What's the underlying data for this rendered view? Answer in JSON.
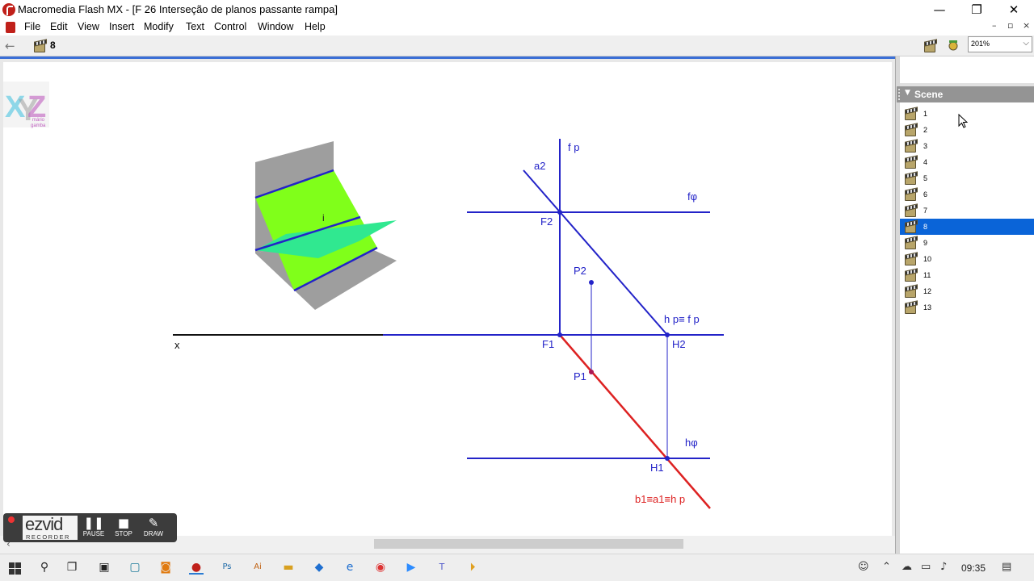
{
  "window": {
    "title": "Macromedia Flash MX - [F 26 Interseção de planos passante rampa]",
    "minimize": "—",
    "maximize": "❐",
    "close": "✕"
  },
  "menu": {
    "items": [
      "File",
      "Edit",
      "View",
      "Insert",
      "Modify",
      "Text",
      "Control",
      "Window",
      "Help"
    ],
    "doc_controls": [
      "–",
      "▫",
      "×"
    ]
  },
  "editbar": {
    "back_glyph": "←",
    "current_scene": "8",
    "zoom": "201%"
  },
  "scene_panel": {
    "title": "Scene",
    "scenes": [
      "1",
      "2",
      "3",
      "4",
      "5",
      "6",
      "7",
      "8",
      "9",
      "10",
      "11",
      "12",
      "13"
    ],
    "selected": "8"
  },
  "stage": {
    "logo_letters": [
      "X",
      "Y",
      "Z"
    ],
    "logo_caption": [
      "mário",
      "gamba"
    ],
    "labels": {
      "fp": "f p",
      "a2": "a2",
      "fphi": "fφ",
      "F2": "F2",
      "P2": "P2",
      "hpfp": "h p≡ f p",
      "x": "x",
      "F1": "F1",
      "H2": "H2",
      "P1": "P1",
      "hphi": "hφ",
      "H1": "H1",
      "b1": "b1≡a1≡h p",
      "i": "i"
    },
    "colors": {
      "construction": "#2323c8",
      "trace": "#dd2222",
      "plane_green": "#80ff1a",
      "plane_cyan": "#30e890",
      "plane_gray": "#9e9e9e"
    }
  },
  "recorder": {
    "logo": "ezvid",
    "logo_sub": "RECORDER",
    "buttons": [
      {
        "label": "PAUSE",
        "glyph": "❚❚"
      },
      {
        "label": "STOP",
        "glyph": "■"
      },
      {
        "label": "DRAW",
        "glyph": "✎"
      }
    ]
  },
  "taskbar": {
    "clock": "09:35"
  }
}
